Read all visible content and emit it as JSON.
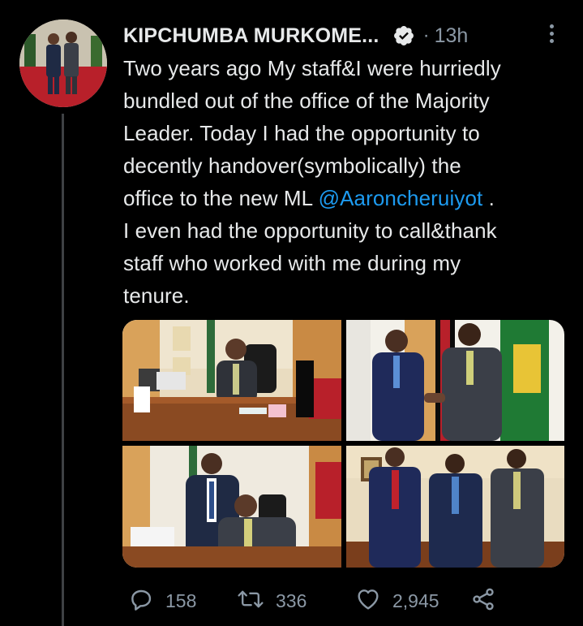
{
  "author": {
    "name": "KIPCHUMBA MURKOME...",
    "verified": true,
    "time": "13h"
  },
  "tweet": {
    "lines": [
      "Two years ago My staff&I were hurriedly",
      "bundled out of the office of the Majority",
      "Leader. Today I had the opportunity to",
      "decently handover(symbolically)  the",
      "office to the new ML ",
      "I even had the opportunity to call&thank",
      "staff who worked with me during my",
      "tenure."
    ],
    "mention": "@Aaroncheruiyot",
    "mention_suffix": " ."
  },
  "stats": {
    "replies": "158",
    "retweets": "336",
    "likes": "2,945"
  },
  "colors": {
    "background": "#000000",
    "text": "#e7e9ea",
    "secondary": "#8b98a5",
    "accent": "#1d9bf0",
    "thread_line": "#3e4144"
  },
  "icons": {
    "verified": "verified-badge-icon",
    "more": "more-vertical-icon",
    "reply": "reply-icon",
    "retweet": "retweet-icon",
    "like": "heart-icon",
    "share": "share-icon"
  }
}
